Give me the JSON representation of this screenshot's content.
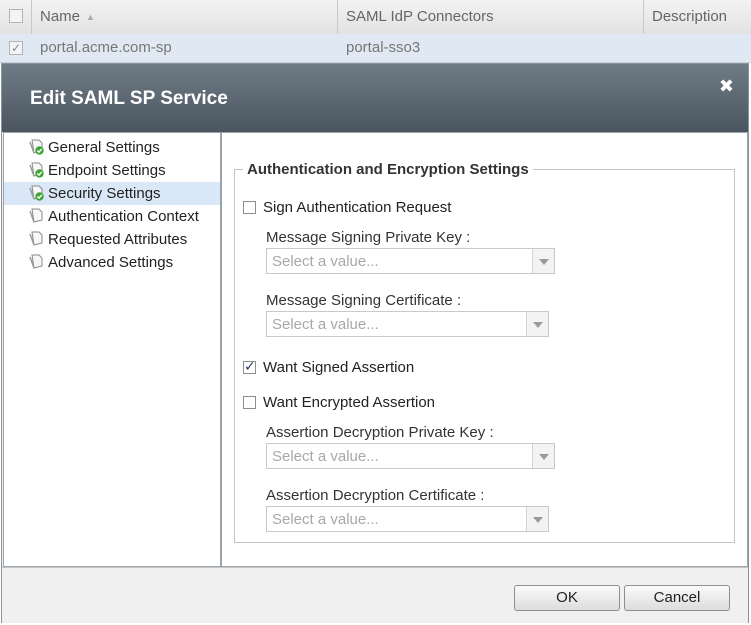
{
  "grid": {
    "columns": [
      "Name",
      "SAML IdP Connectors",
      "Description"
    ],
    "rows": [
      {
        "name": "portal.acme.com-sp",
        "connectors": "portal-sso3",
        "description": ""
      }
    ]
  },
  "dialog": {
    "title": "Edit SAML SP Service",
    "close_symbol": "✖",
    "nav": [
      {
        "label": "General Settings",
        "icon": "document-check-icon"
      },
      {
        "label": "Endpoint Settings",
        "icon": "document-check-icon"
      },
      {
        "label": "Security Settings",
        "icon": "document-check-icon",
        "active": true
      },
      {
        "label": "Authentication Context",
        "icon": "document-icon"
      },
      {
        "label": "Requested Attributes",
        "icon": "document-icon"
      },
      {
        "label": "Advanced Settings",
        "icon": "document-icon"
      }
    ],
    "section": {
      "legend": "Authentication and Encryption Settings",
      "sign_auth_request": {
        "label": "Sign Authentication Request",
        "checked": false
      },
      "msg_signing_key": {
        "label": "Message Signing Private Key",
        "colon": ":",
        "placeholder": "Select a value..."
      },
      "msg_signing_cert": {
        "label": "Message Signing Certificate",
        "colon": ":",
        "placeholder": "Select a value..."
      },
      "want_signed_assertion": {
        "label": "Want Signed Assertion",
        "checked": true
      },
      "want_encrypted_assertion": {
        "label": "Want Encrypted Assertion",
        "checked": false
      },
      "assertion_decrypt_key": {
        "label": "Assertion Decryption Private Key",
        "colon": ":",
        "placeholder": "Select a value..."
      },
      "assertion_decrypt_cert": {
        "label": "Assertion Decryption Certificate",
        "colon": ":",
        "placeholder": "Select a value..."
      }
    },
    "buttons": {
      "ok": "OK",
      "cancel": "Cancel"
    }
  },
  "colors": {
    "header_dark": "#4a5560",
    "active_nav": "#d9e7f7",
    "check_green": "#3fa535"
  }
}
